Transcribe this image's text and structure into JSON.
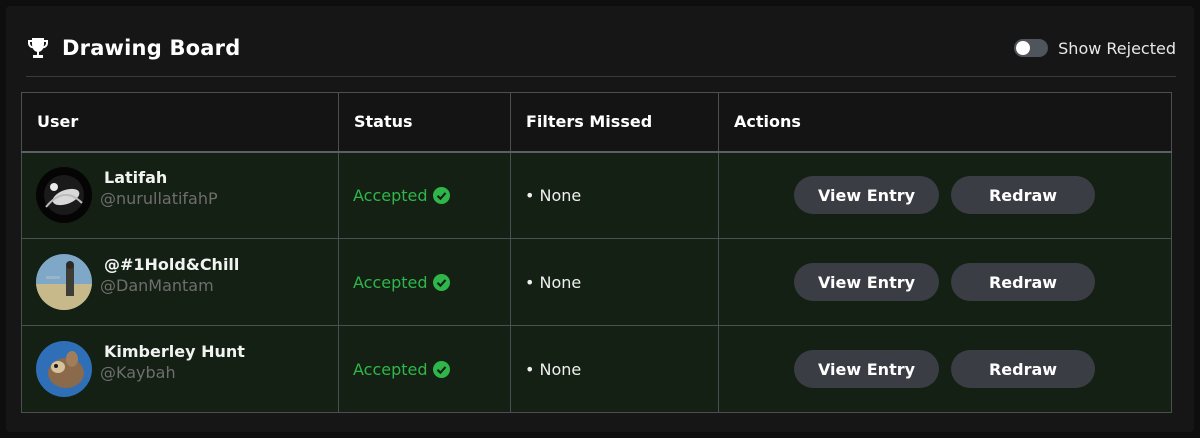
{
  "header": {
    "title": "Drawing Board",
    "toggle_label": "Show Rejected",
    "toggle_on": false
  },
  "table": {
    "columns": [
      "User",
      "Status",
      "Filters Missed",
      "Actions"
    ],
    "rows": [
      {
        "name": "Latifah",
        "handle": "@nurullatifahP",
        "status": "Accepted",
        "filters_missed": "• None",
        "view_label": "View Entry",
        "redraw_label": "Redraw"
      },
      {
        "name": "@#1Hold&Chill",
        "handle": "@DanMantam",
        "status": "Accepted",
        "filters_missed": "• None",
        "view_label": "View Entry",
        "redraw_label": "Redraw"
      },
      {
        "name": "Kimberley Hunt",
        "handle": "@Kaybah",
        "status": "Accepted",
        "filters_missed": "• None",
        "view_label": "View Entry",
        "redraw_label": "Redraw"
      }
    ]
  },
  "colors": {
    "accepted": "#2fb64a",
    "row_background": "#132013",
    "button_background": "#3a3d43"
  },
  "icons": {
    "title": "trophy-icon",
    "status": "check-circle-icon"
  }
}
